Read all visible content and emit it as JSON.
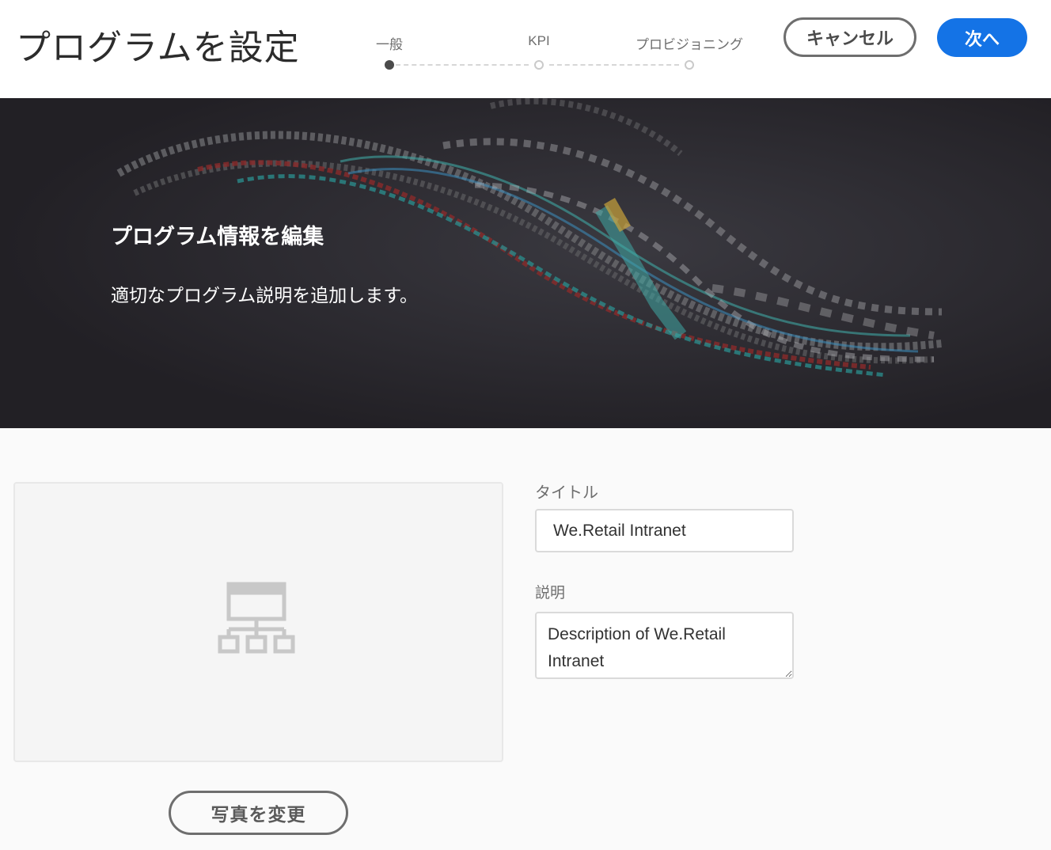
{
  "header": {
    "title": "プログラムを設定",
    "steps": [
      {
        "label": "一般",
        "state": "active"
      },
      {
        "label": "KPI",
        "state": "inactive"
      },
      {
        "label": "プロビジョニング",
        "state": "inactive"
      }
    ],
    "cancel_label": "キャンセル",
    "next_label": "次へ"
  },
  "banner": {
    "title": "プログラム情報を編集",
    "subtitle": "適切なプログラム説明を追加します。"
  },
  "thumbnail": {
    "icon": "sitemap-icon",
    "change_label": "写真を変更"
  },
  "form": {
    "title_label": "タイトル",
    "title_value": "We.Retail Intranet",
    "description_label": "説明",
    "description_value": "Description of We.Retail Intranet"
  },
  "colors": {
    "accent": "#1473e6",
    "banner_bg": "#2a282d",
    "page_bg": "#fafafa"
  }
}
